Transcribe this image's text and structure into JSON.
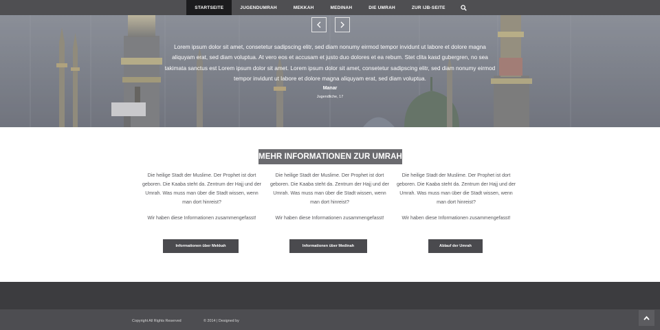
{
  "nav": {
    "items": [
      {
        "label": "STARTSEITE",
        "active": true
      },
      {
        "label": "JUGENDUMRAH",
        "active": false
      },
      {
        "label": "MEKKAH",
        "active": false
      },
      {
        "label": "MEDINAH",
        "active": false
      },
      {
        "label": "DIE UMRAH",
        "active": false
      },
      {
        "label": "ZUR IJB-SEITE",
        "active": false
      }
    ],
    "search_icon": "search-icon"
  },
  "hero": {
    "quote": "Lorem ipsum dolor sit amet, consetetur sadipscing elitr, sed diam nonumy eirmod tempor invidunt ut labore et dolore magna aliquyam erat, sed diam voluptua. At vero eos et accusam et justo duo dolores et ea rebum. Stet clita kasd gubergren, no sea takimata sanctus est Lorem ipsum dolor sit amet. Lorem ipsum dolor sit amet, consetetur sadipscing elitr, sed diam nonumy eirmod tempor invidunt ut labore et dolore magna aliquyam erat, sed diam voluptua.",
    "name": "Manar",
    "role": "Jugendliche, 17",
    "prev_icon": "chevron-left-icon",
    "next_icon": "chevron-right-icon"
  },
  "info": {
    "title": "MEHR INFORMATIONEN ZUR UMRAH",
    "columns": [
      {
        "text1": "Die heilige Stadt der Muslime. Der Prophet ist dort geboren. Die Kaaba steht da. Zentrum der Hajj und der Umrah. Was muss man über die Stadt wissen, wenn man dort hinreist?",
        "text2": "Wir haben diese Informationen zusammengefasst!",
        "button": "Informationen über Mekkah"
      },
      {
        "text1": "Die heilige Stadt der Muslime. Der Prophet ist dort geboren. Die Kaaba steht da. Zentrum der Hajj und der Umrah. Was muss man über die Stadt wissen, wenn man dort hinreist?",
        "text2": "Wir haben diese Informationen zusammengefasst!",
        "button": "Informationen über Medinah"
      },
      {
        "text1": "Die heilige Stadt der Muslime. Der Prophet ist dort geboren. Die Kaaba steht da. Zentrum der Hajj und der Umrah. Was muss man über die Stadt wissen, wenn man dort hinreist?",
        "text2": "Wir haben diese Informationen zusammengefasst!",
        "button": "Ablauf der Umrah"
      }
    ]
  },
  "footer": {
    "copyright": "Copyright All Rights Reserved",
    "designed": "© 2014 | Designed by",
    "to_top_icon": "chevron-up-icon"
  },
  "colors": {
    "nav_bg": "#4f4f52",
    "nav_active": "#1c1c1e",
    "title_bg": "#6b6b6f",
    "button_bg": "#4a4a4e",
    "footer_top": "#3c3c3f",
    "footer_bottom": "#4d4d51"
  }
}
